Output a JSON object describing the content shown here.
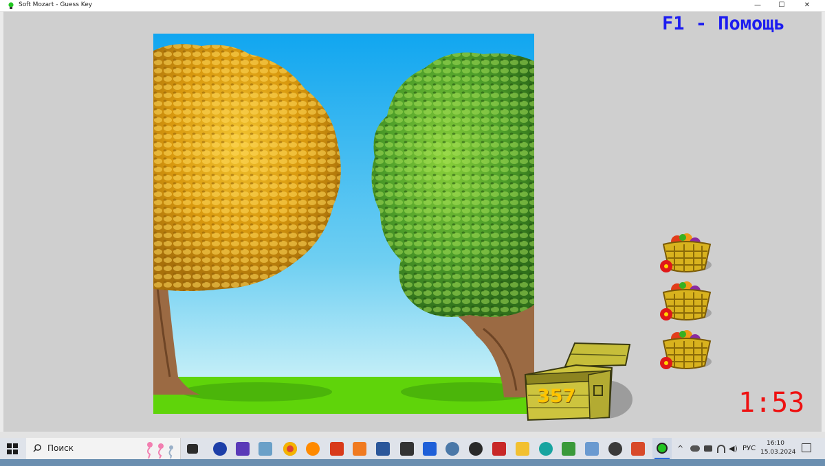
{
  "window": {
    "title": "Soft Mozart - Guess Key",
    "controls": {
      "minimize": "—",
      "maximize": "☐",
      "close": "✕"
    }
  },
  "game": {
    "help_text": "F1 - Помощь",
    "chest_count": "357",
    "timer": "1:53",
    "baskets": [
      {
        "name": "basket-1"
      },
      {
        "name": "basket-2"
      },
      {
        "name": "basket-3"
      }
    ]
  },
  "taskbar": {
    "search_placeholder": "Поиск",
    "pinned_icons": [
      "task-view-icon",
      "app-icon-1",
      "app-icon-2",
      "app-icon-3",
      "chrome-icon",
      "search-app-icon",
      "app-icon-4",
      "media-player-icon",
      "word-icon",
      "app-icon-5",
      "app-icon-6",
      "app-icon-7",
      "app-icon-8",
      "app-icon-9",
      "file-explorer-icon",
      "edge-icon",
      "app-icon-10",
      "app-icon-11",
      "settings-icon",
      "app-icon-12",
      "soft-mozart-icon"
    ],
    "tray": {
      "language": "РУС"
    },
    "clock": {
      "time": "16:10",
      "date": "15.03.2024"
    }
  },
  "colors": {
    "help_text": "#1c1cf0",
    "timer": "#ee1111",
    "chest_count": "#ffc400",
    "sky_top": "#11a6f0",
    "grass": "#5fd40a",
    "client_bg": "#cfcfcf"
  }
}
